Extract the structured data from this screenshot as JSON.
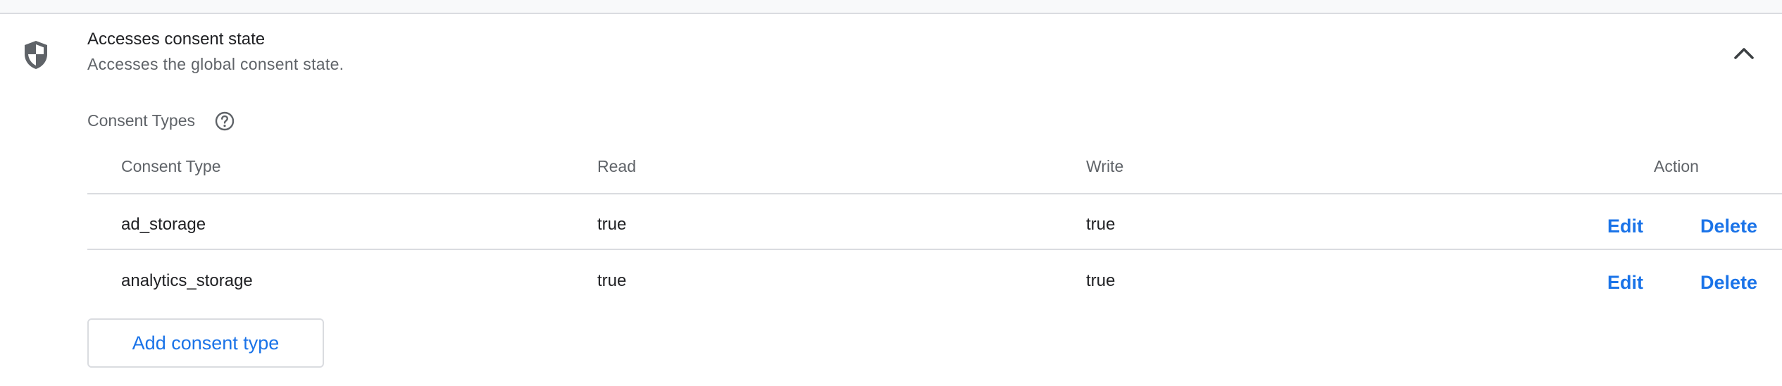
{
  "permission": {
    "icon": "shield-icon",
    "title": "Accesses consent state",
    "subtitle": "Accesses the global consent state.",
    "collapse_icon": "chevron-up-icon"
  },
  "consent_types": {
    "section_label": "Consent Types",
    "help_icon": "help-circle-icon",
    "columns": {
      "type": "Consent Type",
      "read": "Read",
      "write": "Write",
      "action": "Action"
    },
    "rows": [
      {
        "type": "ad_storage",
        "read": "true",
        "write": "true",
        "edit": "Edit",
        "delete": "Delete"
      },
      {
        "type": "analytics_storage",
        "read": "true",
        "write": "true",
        "edit": "Edit",
        "delete": "Delete"
      }
    ],
    "add_button": "Add consent type"
  },
  "colors": {
    "accent": "#1a73e8",
    "text_primary": "#202124",
    "text_secondary": "#5f6368",
    "divider": "#dadce0",
    "icon": "#5f6368"
  }
}
